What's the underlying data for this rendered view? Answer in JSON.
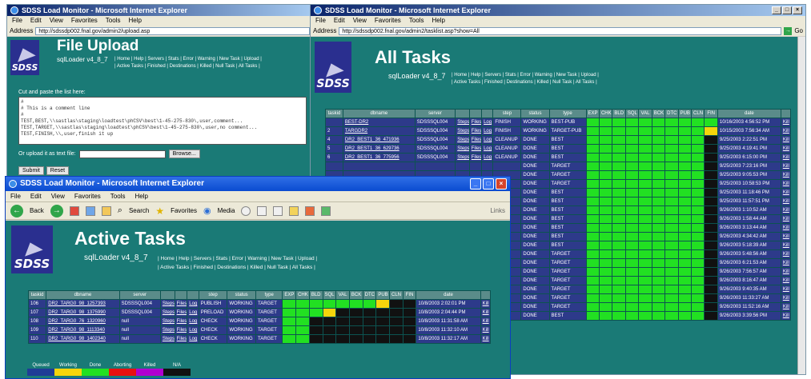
{
  "file_upload": {
    "window_title": "SDSS Load Monitor - Microsoft Internet Explorer",
    "menu": [
      "File",
      "Edit",
      "View",
      "Favorites",
      "Tools",
      "Help"
    ],
    "address_label": "Address",
    "address": "http://sdssdp002.fnal.gov/admin2/upload.asp",
    "title": "File Upload",
    "subtitle": "sqlLoader  v4_8_7",
    "links_row1": "| Home | Help | Servers | Stats | Error | Warning | New Task | Upload |",
    "links_row2": "| Active Tasks | Finished | Destinations | Killed | Null Task | All Tasks |",
    "instruction": "Cut and paste the list here:",
    "textarea_value": "#\n# This is a comment line\n#\nTEST,BEST,\\\\sastlas\\staging\\loadtest\\phCSV\\best\\1-45-275-830\\,user,comment...\nTEST,TARGET,\\\\sastlas\\staging\\loadtest\\phCSV\\best\\1-45-275-830\\,user,no comment...\nTEST,FINISH,\\\\,user,finish it up",
    "file_label": "Or upload it as text file:",
    "browse": "Browse...",
    "submit": "Submit",
    "reset": "Reset"
  },
  "all_tasks": {
    "window_title": "SDSS Load Monitor - Microsoft Internet Explorer",
    "menu": [
      "File",
      "Edit",
      "View",
      "Favorites",
      "Tools",
      "Help"
    ],
    "address_label": "Address",
    "address": "http://sdssdp002.fnal.gov/admin2/tasklist.asp?show=All",
    "go": "Go",
    "title": "All Tasks",
    "subtitle": "sqlLoader  v4_8_7",
    "links_row1": "| Home | Help | Servers | Stats | Error | Warning | New Task | Upload |",
    "links_row2": "| Active Tasks | Finished | Destinations | Killed | Null Task | All Tasks |",
    "headers": [
      "taskid",
      "dbname",
      "server",
      "",
      "",
      "",
      "step",
      "status",
      "type",
      "EXP",
      "CHK",
      "BLD",
      "SQL",
      "VAL",
      "BCK",
      "DTC",
      "PUB",
      "CLN",
      "FIN",
      "date",
      ""
    ],
    "rows": [
      {
        "taskid": "",
        "dbname": "BEST-DR2",
        "server": "SDSSSQL004",
        "step": "FINISH",
        "status": "WORKING",
        "type": "BEST-PUB",
        "date": "10/16/2003 4:56:52 PM",
        "cells": "gggggggggg"
      },
      {
        "taskid": "2",
        "dbname": "TARGDR2",
        "server": "SDSSSQL004",
        "step": "FINISH",
        "status": "WORKING",
        "type": "TARGET-PUB",
        "date": "10/15/2003 7:56:34 AM",
        "cells": "gggggggggy"
      },
      {
        "taskid": "4",
        "dbname": "DR2_BEST1_36_471936",
        "server": "SDSSSQL004",
        "step": "CLEANUP",
        "status": "DONE",
        "type": "BEST",
        "date": "9/25/2003 2:22:51 PM",
        "cells": "gggggggggk"
      },
      {
        "taskid": "5",
        "dbname": "DR2_BEST1_36_629736",
        "server": "SDSSSQL004",
        "step": "CLEANUP",
        "status": "DONE",
        "type": "BEST",
        "date": "9/25/2003 4:19:41 PM",
        "cells": "gggggggggk"
      },
      {
        "taskid": "6",
        "dbname": "DR2_BEST1_36_775956",
        "server": "SDSSSQL004",
        "step": "CLEANUP",
        "status": "DONE",
        "type": "BEST",
        "date": "9/25/2003 6:15:00 PM",
        "cells": "gggggggggk"
      },
      {
        "taskid": "",
        "dbname": "",
        "server": "",
        "step": "",
        "status": "DONE",
        "type": "TARGET",
        "date": "9/25/2003 7:23:16 PM",
        "cells": "gggggggggk"
      },
      {
        "taskid": "",
        "dbname": "",
        "server": "",
        "step": "",
        "status": "DONE",
        "type": "TARGET",
        "date": "9/25/2003 9:05:53 PM",
        "cells": "gggggggggk"
      },
      {
        "taskid": "",
        "dbname": "",
        "server": "",
        "step": "",
        "status": "DONE",
        "type": "TARGET",
        "date": "9/25/2003 10:58:53 PM",
        "cells": "gggggggggk"
      },
      {
        "taskid": "",
        "dbname": "",
        "server": "",
        "step": "",
        "status": "DONE",
        "type": "BEST",
        "date": "9/25/2003 11:18:46 PM",
        "cells": "gggggggggk"
      },
      {
        "taskid": "",
        "dbname": "",
        "server": "",
        "step": "",
        "status": "DONE",
        "type": "BEST",
        "date": "9/25/2003 11:57:51 PM",
        "cells": "gggggggggk"
      },
      {
        "taskid": "",
        "dbname": "",
        "server": "",
        "step": "",
        "status": "DONE",
        "type": "BEST",
        "date": "9/26/2003 1:10:52 AM",
        "cells": "gggggggggk"
      },
      {
        "taskid": "",
        "dbname": "",
        "server": "",
        "step": "",
        "status": "DONE",
        "type": "BEST",
        "date": "9/26/2003 1:58:44 AM",
        "cells": "gggggggggk"
      },
      {
        "taskid": "",
        "dbname": "",
        "server": "",
        "step": "",
        "status": "DONE",
        "type": "BEST",
        "date": "9/26/2003 3:13:44 AM",
        "cells": "gggggggggk"
      },
      {
        "taskid": "",
        "dbname": "",
        "server": "",
        "step": "",
        "status": "DONE",
        "type": "BEST",
        "date": "9/26/2003 4:34:42 AM",
        "cells": "gggggggggk"
      },
      {
        "taskid": "",
        "dbname": "",
        "server": "",
        "step": "",
        "status": "DONE",
        "type": "BEST",
        "date": "9/26/2003 5:18:39 AM",
        "cells": "gggggggggk"
      },
      {
        "taskid": "",
        "dbname": "",
        "server": "",
        "step": "",
        "status": "DONE",
        "type": "TARGET",
        "date": "9/26/2003 5:48:56 AM",
        "cells": "gggggggggk"
      },
      {
        "taskid": "",
        "dbname": "",
        "server": "",
        "step": "",
        "status": "DONE",
        "type": "TARGET",
        "date": "9/26/2003 6:21:53 AM",
        "cells": "gggggggggk"
      },
      {
        "taskid": "",
        "dbname": "",
        "server": "",
        "step": "",
        "status": "DONE",
        "type": "TARGET",
        "date": "9/26/2003 7:56:57 AM",
        "cells": "gggggggggk"
      },
      {
        "taskid": "",
        "dbname": "",
        "server": "",
        "step": "",
        "status": "DONE",
        "type": "TARGET",
        "date": "9/26/2003 8:16:47 AM",
        "cells": "gggggggggk"
      },
      {
        "taskid": "",
        "dbname": "",
        "server": "",
        "step": "",
        "status": "DONE",
        "type": "TARGET",
        "date": "9/26/2003 9:40:35 AM",
        "cells": "gggggggggk"
      },
      {
        "taskid": "",
        "dbname": "",
        "server": "",
        "step": "",
        "status": "DONE",
        "type": "TARGET",
        "date": "9/26/2003 11:33:27 AM",
        "cells": "gggggggggk"
      },
      {
        "taskid": "",
        "dbname": "",
        "server": "",
        "step": "",
        "status": "DONE",
        "type": "TARGET",
        "date": "9/26/2003 11:52:16 AM",
        "cells": "gggggggggk"
      },
      {
        "taskid": "",
        "dbname": "",
        "server": "",
        "step": "",
        "status": "DONE",
        "type": "BEST",
        "date": "9/26/2003 3:39:56 PM",
        "cells": "gggggggggk"
      }
    ]
  },
  "active_tasks": {
    "window_title": "SDSS Load Monitor - Microsoft Internet Explorer",
    "menu": [
      "File",
      "Edit",
      "View",
      "Favorites",
      "Tools",
      "Help"
    ],
    "toolbar": {
      "back": "Back",
      "search": "Search",
      "favorites": "Favorites",
      "media": "Media",
      "links": "Links"
    },
    "title": "Active Tasks",
    "subtitle": "sqlLoader  v4_8_7",
    "links_row1": "| Home | Help | Servers | Stats | Error | Warning | New Task | Upload |",
    "links_row2": "| Active Tasks | Finished | Destinations | Killed | Null Task | All Tasks |",
    "headers": [
      "taskid",
      "dbname",
      "server",
      "",
      "",
      "",
      "step",
      "status",
      "type",
      "EXP",
      "CHK",
      "BLD",
      "SQL",
      "VAL",
      "BCK",
      "DTC",
      "PUB",
      "CLN",
      "FIN",
      "date",
      ""
    ],
    "rows": [
      {
        "taskid": "106",
        "dbname": "DR2_TARG0_98_1257393",
        "server": "SDSSSQL004",
        "step": "PUBLISH",
        "status": "WORKING",
        "type": "TARGET",
        "date": "10/8/2003 2:02:01 PM",
        "cells": "gggggggykk"
      },
      {
        "taskid": "107",
        "dbname": "DR2_TARG0_98_1375990",
        "server": "SDSSSQL004",
        "step": "PRELOAD",
        "status": "WORKING",
        "type": "TARGET",
        "date": "10/8/2003 2:04:44 PM",
        "cells": "gggykkkkkk"
      },
      {
        "taskid": "108",
        "dbname": "DR2_TARG0_76_1320960",
        "server": "null",
        "step": "CHECK",
        "status": "WORKING",
        "type": "TARGET",
        "date": "10/8/2003 11:31:58 AM",
        "cells": "ggkkkkkkkk"
      },
      {
        "taskid": "109",
        "dbname": "DR2_TARG0_98_1113340",
        "server": "null",
        "step": "CHECK",
        "status": "WORKING",
        "type": "TARGET",
        "date": "10/8/2003 11:32:10 AM",
        "cells": "ggkkkkkkkk"
      },
      {
        "taskid": "110",
        "dbname": "DR2_TARG0_98_1402340",
        "server": "null",
        "step": "CHECK",
        "status": "WORKING",
        "type": "TARGET",
        "date": "10/8/2003 11:32:17 AM",
        "cells": "ggkkkkkkkk"
      }
    ],
    "row_links": [
      "Steps",
      "Files",
      "Log"
    ],
    "kill": "Kill",
    "legend": [
      {
        "label": "Queued",
        "color": "#1f3d96"
      },
      {
        "label": "Working",
        "color": "#f5d50b"
      },
      {
        "label": "Done",
        "color": "#22e022"
      },
      {
        "label": "Aborting",
        "color": "#e81010"
      },
      {
        "label": "Killed",
        "color": "#b000d0"
      },
      {
        "label": "N/A",
        "color": "#111111"
      }
    ]
  }
}
